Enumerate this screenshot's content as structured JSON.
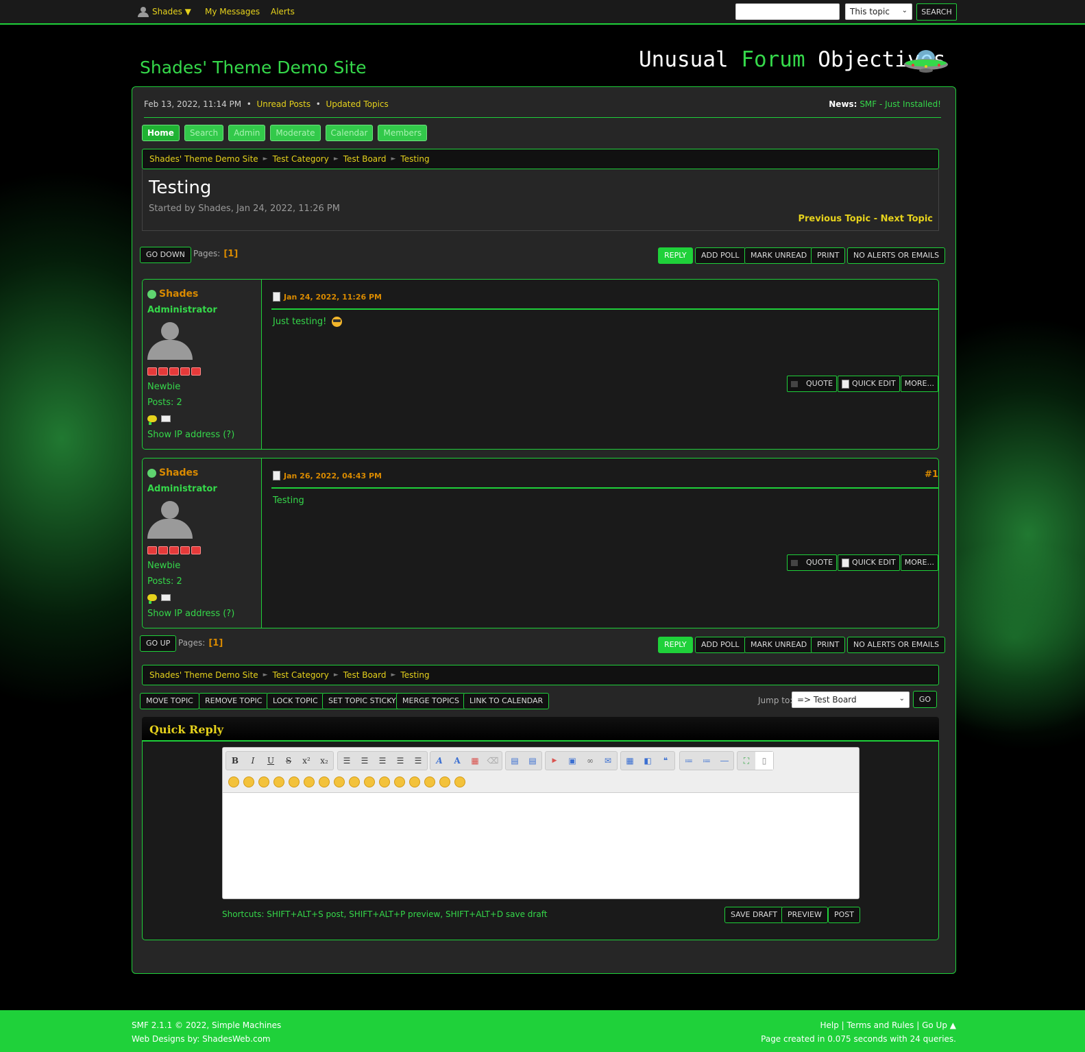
{
  "topbar": {
    "user": "Shades ▼",
    "nav": [
      "My Messages",
      "Alerts"
    ],
    "search_placeholder": "",
    "search_scope": "This topic",
    "search_button": "SEARCH"
  },
  "header": {
    "site_title": "Shades' Theme Demo Site",
    "slogan_white": "Unusual ",
    "slogan_green": "Forum",
    "slogan_white2": " Objectives"
  },
  "upper": {
    "date": "Feb 13, 2022, 11:14 PM",
    "bullet": "•",
    "unread": "Unread Posts",
    "updated": "Updated Topics",
    "news_label": "News:",
    "news_text": "SMF - Just Installed!"
  },
  "menu": [
    "Home",
    "Search",
    "Admin",
    "Moderate",
    "Calendar",
    "Members"
  ],
  "breadcrumb": [
    "Shades' Theme Demo Site",
    "Test Category",
    "Test Board",
    "Testing"
  ],
  "topic": {
    "title": "Testing",
    "started": "Started by Shades, Jan 24, 2022, 11:26 PM",
    "prev": "Previous Topic",
    "dash": " - ",
    "next": "Next Topic"
  },
  "pagination": {
    "go_down": "GO DOWN",
    "go_up": "GO UP",
    "pages_label": "Pages:",
    "pages_value": "[1]"
  },
  "topic_buttons": [
    "REPLY",
    "ADD POLL",
    "MARK UNREAD",
    "PRINT",
    "NO ALERTS OR EMAILS"
  ],
  "posts": [
    {
      "name": "Shades",
      "group": "Administrator",
      "rank": "Newbie",
      "posts": "Posts: 2",
      "ip": "Show IP address (?)",
      "date": "Jan 24, 2022, 11:26 PM",
      "counter": "",
      "body": "Just testing!"
    },
    {
      "name": "Shades",
      "group": "Administrator",
      "rank": "Newbie",
      "posts": "Posts: 2",
      "ip": "Show IP address (?)",
      "date": "Jan 26, 2022, 04:43 PM",
      "counter": "#1",
      "body": "Testing"
    }
  ],
  "post_buttons": [
    "QUOTE",
    "QUICK EDIT",
    "MORE..."
  ],
  "mod_buttons": [
    "MOVE TOPIC",
    "REMOVE TOPIC",
    "LOCK TOPIC",
    "SET TOPIC STICKY",
    "MERGE TOPICS",
    "LINK TO CALENDAR"
  ],
  "jump": {
    "label": "Jump to:",
    "selected": "=> Test Board",
    "go": "GO"
  },
  "quick_reply": {
    "title": "Quick Reply",
    "shortcuts": "Shortcuts: SHIFT+ALT+S post, SHIFT+ALT+P preview, SHIFT+ALT+D save draft",
    "buttons": [
      "SAVE DRAFT",
      "PREVIEW",
      "POST"
    ],
    "toolbar_text": [
      "B",
      "I",
      "U",
      "S",
      "x²",
      "x₂"
    ]
  },
  "footer": {
    "copyright": "SMF 2.1.1 © 2022, Simple Machines",
    "designs": "Web Designs by: ShadesWeb.com",
    "links": "Help | Terms and Rules | Go Up ▲",
    "stats": "Page created in 0.075 seconds with 24 queries."
  },
  "colors": {
    "accent": "#1fd13a",
    "link": "#e6d21c",
    "name": "#d98a00"
  }
}
